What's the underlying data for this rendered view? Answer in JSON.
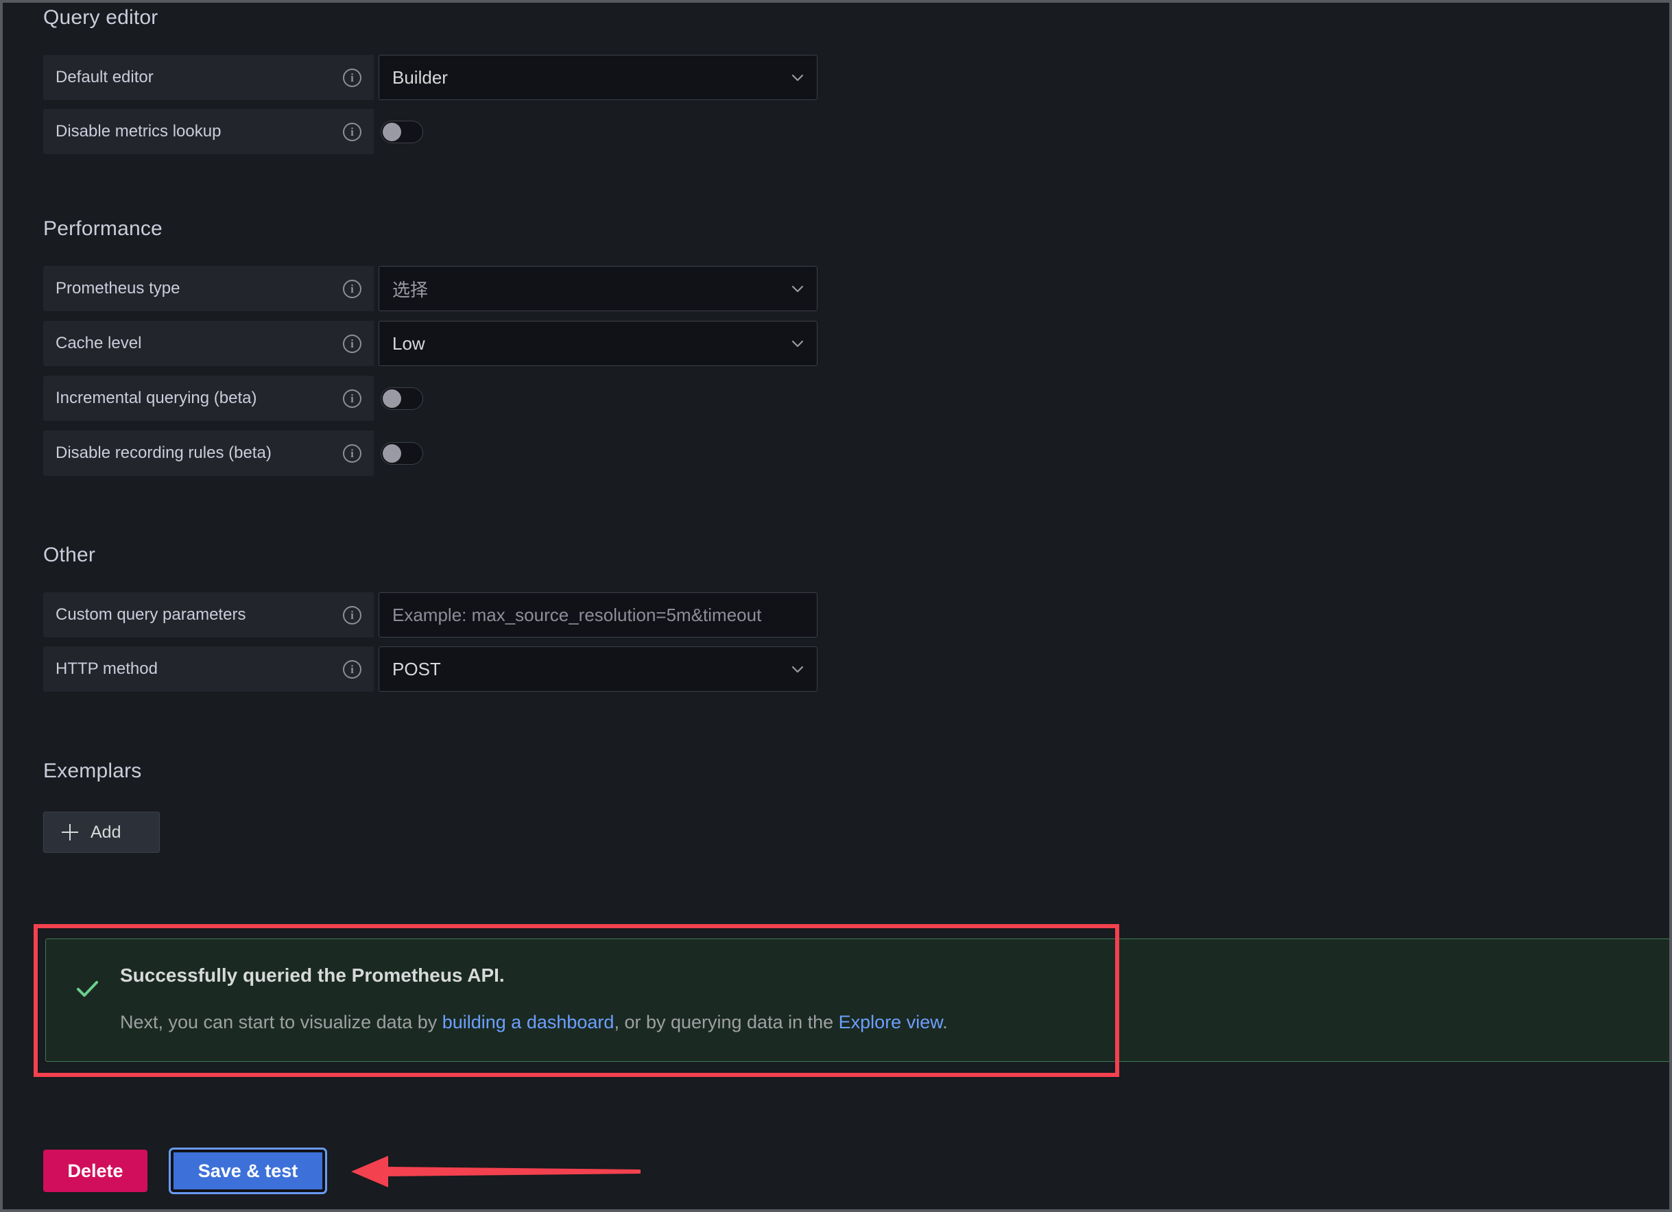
{
  "sections": {
    "query_editor": {
      "title": "Query editor",
      "fields": [
        {
          "label": "Default editor",
          "control": "select",
          "value": "Builder",
          "icon": "info-icon"
        },
        {
          "label": "Disable metrics lookup",
          "control": "toggle",
          "value": "off",
          "icon": "info-icon"
        }
      ]
    },
    "performance": {
      "title": "Performance",
      "fields": [
        {
          "label": "Prometheus type",
          "control": "select",
          "value": "选择",
          "is_placeholder": true,
          "icon": "info-icon"
        },
        {
          "label": "Cache level",
          "control": "select",
          "value": "Low",
          "icon": "info-icon"
        },
        {
          "label": "Incremental querying (beta)",
          "control": "toggle",
          "value": "off",
          "icon": "info-icon"
        },
        {
          "label": "Disable recording rules (beta)",
          "control": "toggle",
          "value": "off",
          "icon": "info-icon"
        }
      ]
    },
    "other": {
      "title": "Other",
      "fields": [
        {
          "label": "Custom query parameters",
          "control": "input",
          "value": "",
          "placeholder": "Example: max_source_resolution=5m&timeout",
          "icon": "info-icon"
        },
        {
          "label": "HTTP method",
          "control": "select",
          "value": "POST",
          "icon": "info-icon"
        }
      ]
    },
    "exemplars": {
      "title": "Exemplars",
      "add_button_label": "Add",
      "add_button_icon": "plus-icon"
    }
  },
  "alert": {
    "icon": "check-icon",
    "title": "Successfully queried the Prometheus API.",
    "body_prefix": "Next, you can start to visualize data by ",
    "link_dashboard": "building a dashboard",
    "body_middle": ", or by querying data in the ",
    "link_explore": "Explore view",
    "body_suffix": ".",
    "accent_color": "#3e7a56",
    "background_color": "#1a2a22",
    "check_color": "#6ccf8e"
  },
  "footer": {
    "delete_label": "Delete",
    "save_test_label": "Save & test",
    "delete_color": "#d10e5c",
    "save_color": "#3d71d9",
    "focus_ring_color": "#6a9bf4"
  },
  "annotations": {
    "highlight_box_color": "#f4414f",
    "arrow_color": "#f4414f",
    "arrow_direction": "left"
  }
}
